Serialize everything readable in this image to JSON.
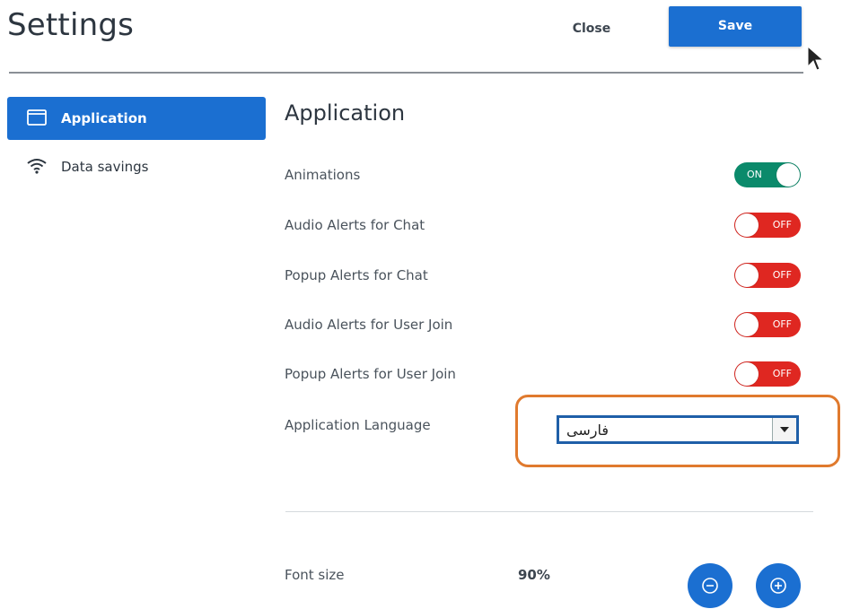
{
  "header": {
    "title": "Settings",
    "close_label": "Close",
    "save_label": "Save"
  },
  "sidebar": {
    "items": [
      {
        "label": "Application",
        "icon": "window-icon",
        "active": true
      },
      {
        "label": "Data savings",
        "icon": "wifi-icon",
        "active": false
      }
    ]
  },
  "main": {
    "section_title": "Application",
    "settings": [
      {
        "label": "Animations",
        "state": "ON"
      },
      {
        "label": "Audio Alerts for Chat",
        "state": "OFF"
      },
      {
        "label": "Popup Alerts for Chat",
        "state": "OFF"
      },
      {
        "label": "Audio Alerts for User Join",
        "state": "OFF"
      },
      {
        "label": "Popup Alerts for User Join",
        "state": "OFF"
      }
    ],
    "language": {
      "label": "Application Language",
      "selected": "فارسی"
    },
    "font_size": {
      "label": "Font size",
      "value": "90%"
    }
  },
  "colors": {
    "accent": "#1b6fd1",
    "toggle_on": "#0b8a6b",
    "toggle_off": "#df2721",
    "highlight": "#e07a2e"
  }
}
